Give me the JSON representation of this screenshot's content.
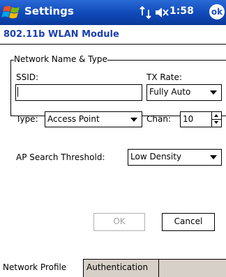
{
  "titlebar": {
    "title": "Settings",
    "clock": "1:58",
    "ok_label": "ok"
  },
  "subtitle": "802.11b WLAN Module",
  "group": {
    "title": "Network Name & Type",
    "ssid_label": "SSID:",
    "ssid_value": "",
    "tx_rate_label": "TX Rate:",
    "tx_rate_value": "Fully Auto",
    "type_label": "Type:",
    "type_value": "Access Point",
    "chan_label": "Chan:",
    "chan_value": "10"
  },
  "ap_search": {
    "label": "AP Search Threshold:",
    "value": "Low Density"
  },
  "buttons": {
    "ok": "OK",
    "cancel": "Cancel"
  },
  "tabs": [
    {
      "label": "Network Profile",
      "active": true
    },
    {
      "label": "Authentication",
      "active": false
    }
  ]
}
